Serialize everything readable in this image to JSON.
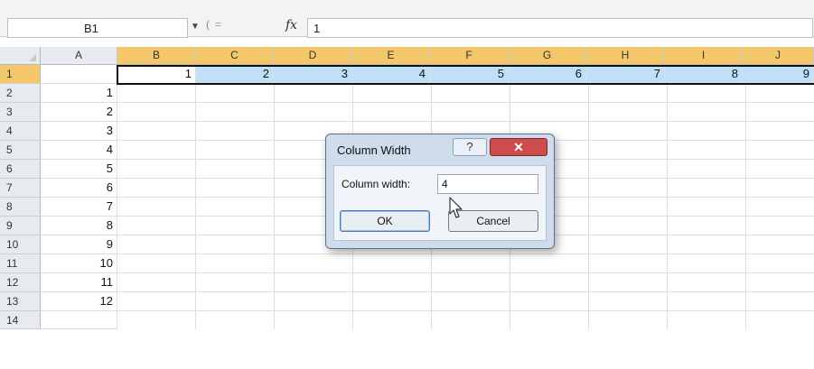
{
  "formula_bar": {
    "name_box": "B1",
    "fx_label": "fx",
    "content": "1"
  },
  "columns": [
    "A",
    "B",
    "C",
    "D",
    "E",
    "F",
    "G",
    "H",
    "I",
    "J"
  ],
  "rows": [
    "1",
    "2",
    "3",
    "4",
    "5",
    "6",
    "7",
    "8",
    "9",
    "10",
    "11",
    "12",
    "13",
    "14"
  ],
  "column_a_values": [
    "",
    "1",
    "2",
    "3",
    "4",
    "5",
    "6",
    "7",
    "8",
    "9",
    "10",
    "11",
    "12",
    ""
  ],
  "row1_values": [
    "1",
    "2",
    "3",
    "4",
    "5",
    "6",
    "7",
    "8",
    "9"
  ],
  "dialog": {
    "title": "Column Width",
    "help": "?",
    "close": "✕",
    "label": "Column width:",
    "value": "4",
    "ok": "OK",
    "cancel": "Cancel"
  },
  "colors": {
    "selected_header": "#f4c76a",
    "selected_cell": "#bfe0f7",
    "close_button": "#cc4d4b"
  }
}
